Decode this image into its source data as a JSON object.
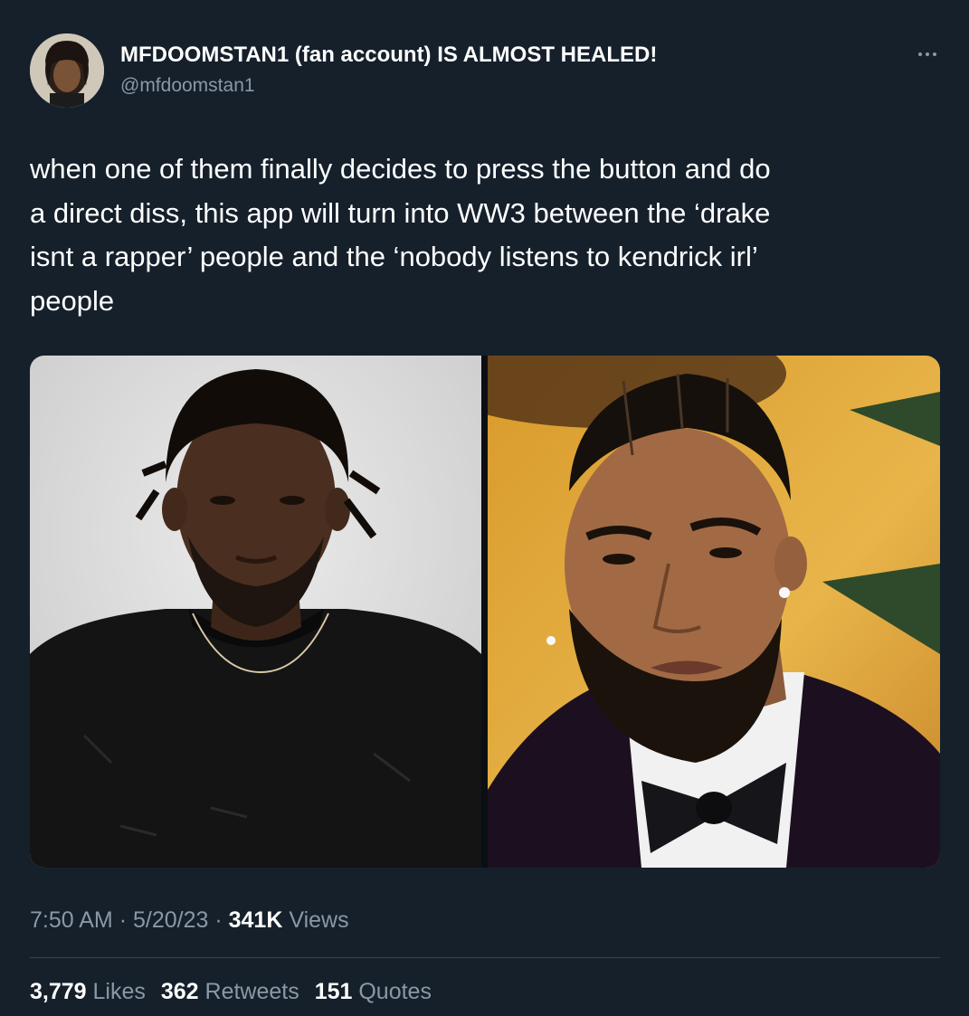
{
  "author": {
    "display_name": "MFDOOMSTAN1 (fan account) IS ALMOST HEALED!",
    "handle": "@mfdoomstan1",
    "avatar_icon": "user-avatar"
  },
  "menu": {
    "icon": "more-options-icon"
  },
  "tweet": {
    "lines": [
      "when one of them finally decides to press the button and do",
      "a direct diss, this app will turn into WW3 between the ‘drake",
      "isnt a rapper’ people and the ‘nobody listens to kendrick irl’",
      "people"
    ]
  },
  "media": {
    "images": [
      "portrait-photo-left",
      "portrait-photo-right"
    ]
  },
  "meta": {
    "time": "7:50 AM",
    "separator": "·",
    "date": "5/20/23",
    "views_count": "341K",
    "views_label": "Views"
  },
  "stats": {
    "likes_count": "3,779",
    "likes_label": "Likes",
    "retweets_count": "362",
    "retweets_label": "Retweets",
    "quotes_count": "151",
    "quotes_label": "Quotes"
  },
  "colors": {
    "background": "#15202b",
    "text_primary": "#ffffff",
    "text_secondary": "#8b98a5",
    "divider": "#38444d"
  }
}
